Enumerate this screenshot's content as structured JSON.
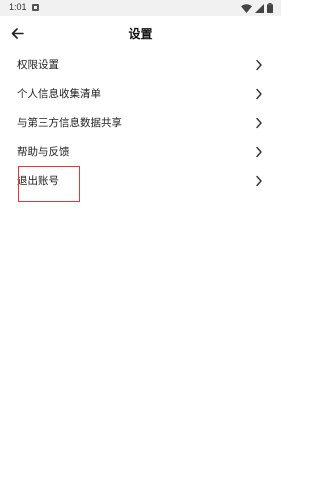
{
  "status_bar": {
    "time": "1:01",
    "icons": [
      "notification-icon",
      "wifi-icon",
      "signal-icon",
      "battery-icon"
    ]
  },
  "header": {
    "title": "设置",
    "back_icon": "arrow-left-icon"
  },
  "menu": {
    "items": [
      {
        "label": "权限设置",
        "icon": "chevron-right-icon"
      },
      {
        "label": "个人信息收集清单",
        "icon": "chevron-right-icon"
      },
      {
        "label": "与第三方信息数据共享",
        "icon": "chevron-right-icon"
      },
      {
        "label": "帮助与反馈",
        "icon": "chevron-right-icon"
      },
      {
        "label": "退出账号",
        "icon": "chevron-right-icon"
      }
    ]
  },
  "colors": {
    "highlight_border": "#e53935",
    "status_bar_bg": "#f1f1f1",
    "text": "#222222"
  }
}
